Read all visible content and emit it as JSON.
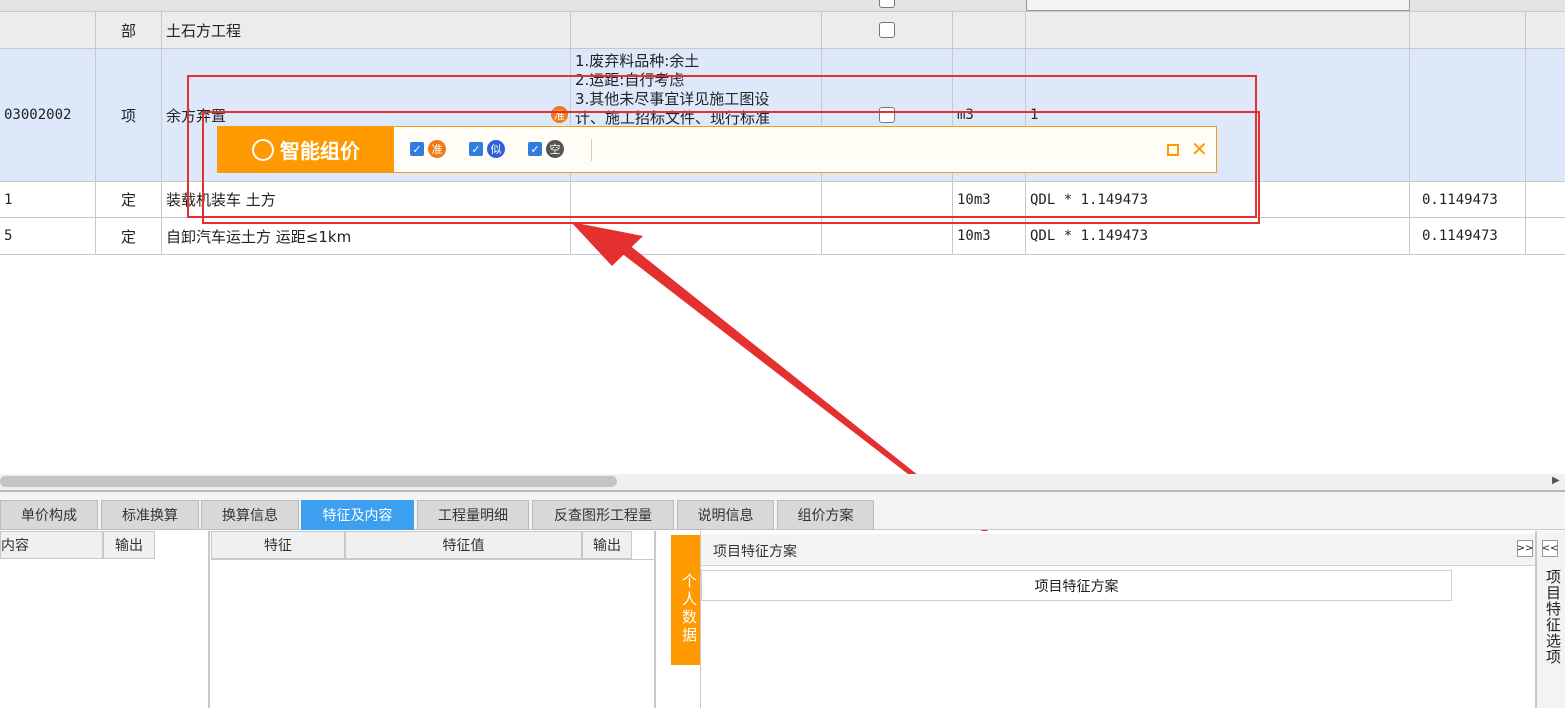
{
  "grid": {
    "rows": [
      {
        "code": "",
        "type": "部",
        "name": "土石方工程",
        "feature": "",
        "unit": "",
        "qty": "",
        "price": ""
      },
      {
        "code": "03002002",
        "type": "项",
        "name": "余方弃置",
        "feature_lines": [
          "1.废弃料品种:余土",
          "2.运距:自行考虑",
          "3.其他未尽事宜详见施工图设",
          "计、施工招标文件、现行标准"
        ],
        "unit": "m3",
        "qty": "1",
        "price": ""
      },
      {
        "code": "1",
        "type": "定",
        "name": "装载机装车 土方",
        "feature": "",
        "unit": "10m3",
        "qty": "QDL * 1.149473",
        "price": "0.1149473"
      },
      {
        "code": "5",
        "type": "定",
        "name": "自卸汽车运土方 运距≤1km",
        "feature": "",
        "unit": "10m3",
        "qty": "QDL * 1.149473",
        "price": "0.1149473"
      }
    ]
  },
  "smart_pricing": {
    "title": "智能组价",
    "options": [
      {
        "checked": true,
        "icon": "准",
        "color": "#f07a1a"
      },
      {
        "checked": true,
        "icon": "似",
        "color": "#2f62d8"
      },
      {
        "checked": true,
        "icon": "空",
        "color": "#555555"
      }
    ],
    "row_badge": "准"
  },
  "tabs": [
    "单价构成",
    "标准换算",
    "换算信息",
    "特征及内容",
    "工程量明细",
    "反查图形工程量",
    "说明信息",
    "组价方案"
  ],
  "active_tab": "特征及内容",
  "left_pane": {
    "col_content": "内容",
    "col_output": "输出"
  },
  "feature_pane": {
    "col_feature": "特征",
    "col_value": "特征值",
    "col_output": "输出"
  },
  "personal_data_tab": "个人数据",
  "scheme_panel": {
    "title": "项目特征方案",
    "header": "项目特征方案",
    "expand_label": ">>"
  },
  "side_panel": {
    "label": "项目特征选项",
    "collapse_label": "<<"
  },
  "accent_colors": {
    "orange": "#ff9900",
    "tab_blue": "#3c9ff0",
    "selected_row": "#dde9fb",
    "annotation_red": "#e53030"
  }
}
